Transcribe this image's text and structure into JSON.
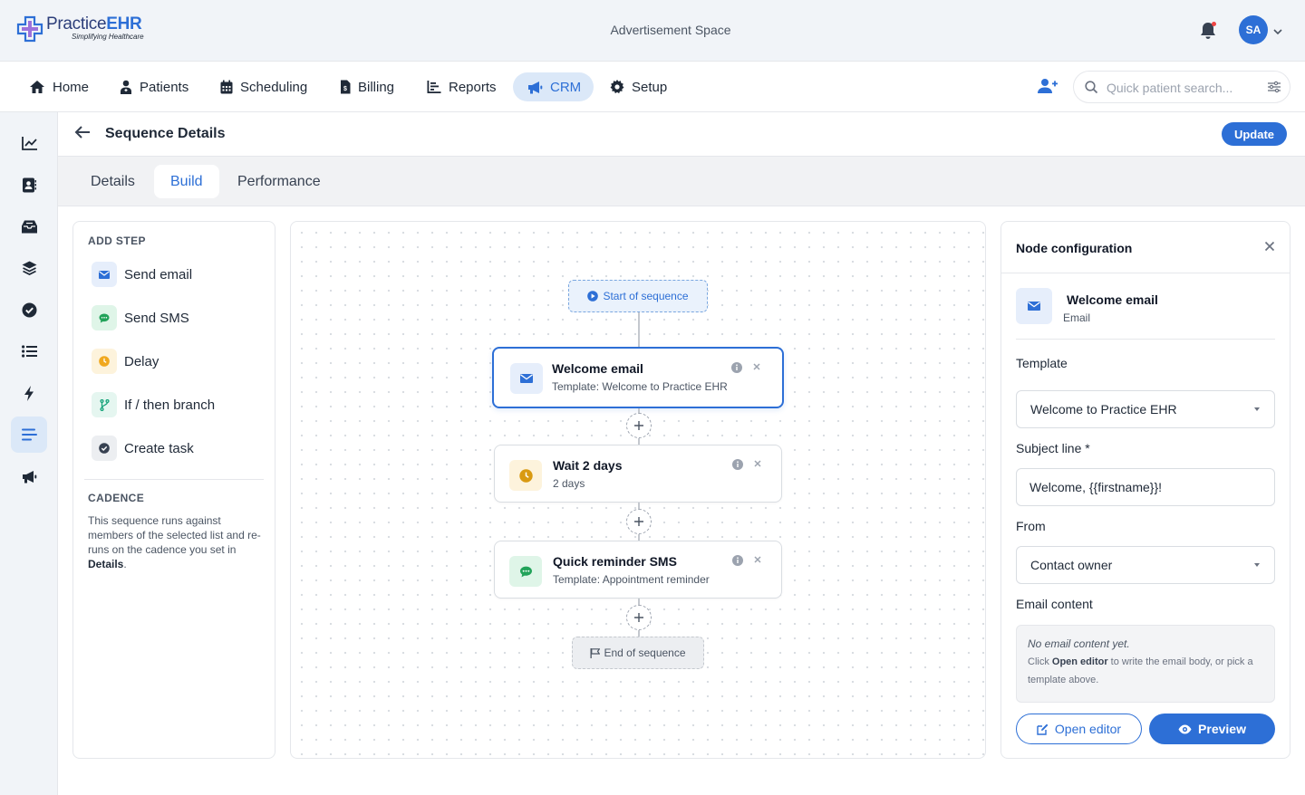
{
  "brand": {
    "name_part1": "Practice",
    "name_part2": "EHR",
    "tagline": "Simplifying Healthcare"
  },
  "header": {
    "ad_text": "Advertisement Space",
    "avatar_initials": "SA"
  },
  "nav": {
    "items": [
      {
        "label": "Home",
        "icon": "home-icon"
      },
      {
        "label": "Patients",
        "icon": "patients-icon"
      },
      {
        "label": "Scheduling",
        "icon": "calendar-icon"
      },
      {
        "label": "Billing",
        "icon": "billing-icon"
      },
      {
        "label": "Reports",
        "icon": "reports-icon"
      },
      {
        "label": "CRM",
        "icon": "megaphone-icon",
        "active": true
      },
      {
        "label": "Setup",
        "icon": "gear-icon"
      }
    ],
    "search_placeholder": "Quick patient search..."
  },
  "rail": [
    "chart-line-icon",
    "contacts-icon",
    "inbox-icon",
    "layers-icon",
    "check-circle-icon",
    "list-icon",
    "bolt-icon",
    "sequence-icon",
    "megaphone-icon"
  ],
  "page": {
    "title": "Sequence Details",
    "update_label": "Update"
  },
  "tabs": [
    {
      "label": "Details"
    },
    {
      "label": "Build",
      "active": true
    },
    {
      "label": "Performance"
    }
  ],
  "add_step": {
    "heading": "ADD STEP",
    "items": [
      {
        "label": "Send email",
        "icon": "envelope-icon"
      },
      {
        "label": "Send SMS",
        "icon": "chat-icon"
      },
      {
        "label": "Delay",
        "icon": "clock-icon"
      },
      {
        "label": "If / then branch",
        "icon": "branch-icon"
      },
      {
        "label": "Create task",
        "icon": "check-icon"
      }
    ],
    "cadence_heading": "CADENCE",
    "cadence_text_1": "This sequence runs against members of the selected list and re-runs on the cadence you set in ",
    "cadence_link": "Details",
    "cadence_text_2": "."
  },
  "flow": {
    "start_label": "Start of sequence",
    "end_label": "End of sequence",
    "nodes": [
      {
        "title": "Welcome email",
        "subtitle": "Template: Welcome to Practice EHR",
        "icon": "envelope-icon",
        "selected": true
      },
      {
        "title": "Wait 2 days",
        "subtitle": "2 days",
        "icon": "clock-icon"
      },
      {
        "title": "Quick reminder SMS",
        "subtitle": "Template: Appointment reminder",
        "icon": "chat-icon"
      }
    ]
  },
  "config": {
    "title": "Node configuration",
    "node_name": "Welcome email",
    "node_type": "Email",
    "template_label": "Template",
    "template_value": "Welcome to Practice EHR",
    "subject_label": "Subject line *",
    "subject_value": "Welcome, {{firstname}}!",
    "from_label": "From",
    "from_value": "Contact owner",
    "content_label": "Email content",
    "content_empty": "No email content yet.",
    "content_hint_1": "Click ",
    "content_hint_bold": "Open editor",
    "content_hint_2": " to write the email body, or pick a template above.",
    "open_editor_label": "Open editor",
    "preview_label": "Preview"
  },
  "colors": {
    "accent": "#2d6fd6",
    "accent_light": "#dbe8f8",
    "email": "#e6eefb",
    "sms": "#dff5e8",
    "delay": "#fdf3dc"
  }
}
